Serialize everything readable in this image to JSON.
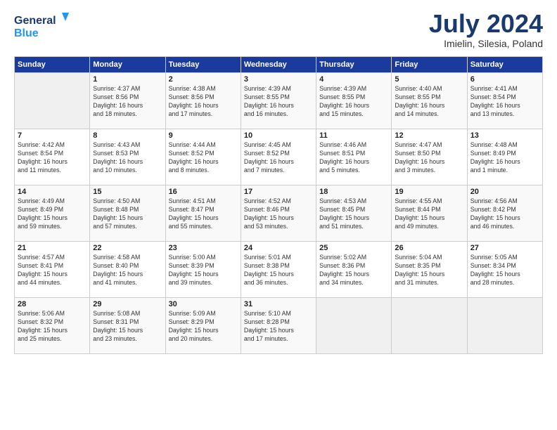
{
  "header": {
    "logo_line1": "General",
    "logo_line2": "Blue",
    "month": "July 2024",
    "location": "Imielin, Silesia, Poland"
  },
  "weekdays": [
    "Sunday",
    "Monday",
    "Tuesday",
    "Wednesday",
    "Thursday",
    "Friday",
    "Saturday"
  ],
  "weeks": [
    [
      {
        "day": "",
        "info": ""
      },
      {
        "day": "1",
        "info": "Sunrise: 4:37 AM\nSunset: 8:56 PM\nDaylight: 16 hours\nand 18 minutes."
      },
      {
        "day": "2",
        "info": "Sunrise: 4:38 AM\nSunset: 8:56 PM\nDaylight: 16 hours\nand 17 minutes."
      },
      {
        "day": "3",
        "info": "Sunrise: 4:39 AM\nSunset: 8:55 PM\nDaylight: 16 hours\nand 16 minutes."
      },
      {
        "day": "4",
        "info": "Sunrise: 4:39 AM\nSunset: 8:55 PM\nDaylight: 16 hours\nand 15 minutes."
      },
      {
        "day": "5",
        "info": "Sunrise: 4:40 AM\nSunset: 8:55 PM\nDaylight: 16 hours\nand 14 minutes."
      },
      {
        "day": "6",
        "info": "Sunrise: 4:41 AM\nSunset: 8:54 PM\nDaylight: 16 hours\nand 13 minutes."
      }
    ],
    [
      {
        "day": "7",
        "info": "Sunrise: 4:42 AM\nSunset: 8:54 PM\nDaylight: 16 hours\nand 11 minutes."
      },
      {
        "day": "8",
        "info": "Sunrise: 4:43 AM\nSunset: 8:53 PM\nDaylight: 16 hours\nand 10 minutes."
      },
      {
        "day": "9",
        "info": "Sunrise: 4:44 AM\nSunset: 8:52 PM\nDaylight: 16 hours\nand 8 minutes."
      },
      {
        "day": "10",
        "info": "Sunrise: 4:45 AM\nSunset: 8:52 PM\nDaylight: 16 hours\nand 7 minutes."
      },
      {
        "day": "11",
        "info": "Sunrise: 4:46 AM\nSunset: 8:51 PM\nDaylight: 16 hours\nand 5 minutes."
      },
      {
        "day": "12",
        "info": "Sunrise: 4:47 AM\nSunset: 8:50 PM\nDaylight: 16 hours\nand 3 minutes."
      },
      {
        "day": "13",
        "info": "Sunrise: 4:48 AM\nSunset: 8:49 PM\nDaylight: 16 hours\nand 1 minute."
      }
    ],
    [
      {
        "day": "14",
        "info": "Sunrise: 4:49 AM\nSunset: 8:49 PM\nDaylight: 15 hours\nand 59 minutes."
      },
      {
        "day": "15",
        "info": "Sunrise: 4:50 AM\nSunset: 8:48 PM\nDaylight: 15 hours\nand 57 minutes."
      },
      {
        "day": "16",
        "info": "Sunrise: 4:51 AM\nSunset: 8:47 PM\nDaylight: 15 hours\nand 55 minutes."
      },
      {
        "day": "17",
        "info": "Sunrise: 4:52 AM\nSunset: 8:46 PM\nDaylight: 15 hours\nand 53 minutes."
      },
      {
        "day": "18",
        "info": "Sunrise: 4:53 AM\nSunset: 8:45 PM\nDaylight: 15 hours\nand 51 minutes."
      },
      {
        "day": "19",
        "info": "Sunrise: 4:55 AM\nSunset: 8:44 PM\nDaylight: 15 hours\nand 49 minutes."
      },
      {
        "day": "20",
        "info": "Sunrise: 4:56 AM\nSunset: 8:42 PM\nDaylight: 15 hours\nand 46 minutes."
      }
    ],
    [
      {
        "day": "21",
        "info": "Sunrise: 4:57 AM\nSunset: 8:41 PM\nDaylight: 15 hours\nand 44 minutes."
      },
      {
        "day": "22",
        "info": "Sunrise: 4:58 AM\nSunset: 8:40 PM\nDaylight: 15 hours\nand 41 minutes."
      },
      {
        "day": "23",
        "info": "Sunrise: 5:00 AM\nSunset: 8:39 PM\nDaylight: 15 hours\nand 39 minutes."
      },
      {
        "day": "24",
        "info": "Sunrise: 5:01 AM\nSunset: 8:38 PM\nDaylight: 15 hours\nand 36 minutes."
      },
      {
        "day": "25",
        "info": "Sunrise: 5:02 AM\nSunset: 8:36 PM\nDaylight: 15 hours\nand 34 minutes."
      },
      {
        "day": "26",
        "info": "Sunrise: 5:04 AM\nSunset: 8:35 PM\nDaylight: 15 hours\nand 31 minutes."
      },
      {
        "day": "27",
        "info": "Sunrise: 5:05 AM\nSunset: 8:34 PM\nDaylight: 15 hours\nand 28 minutes."
      }
    ],
    [
      {
        "day": "28",
        "info": "Sunrise: 5:06 AM\nSunset: 8:32 PM\nDaylight: 15 hours\nand 25 minutes."
      },
      {
        "day": "29",
        "info": "Sunrise: 5:08 AM\nSunset: 8:31 PM\nDaylight: 15 hours\nand 23 minutes."
      },
      {
        "day": "30",
        "info": "Sunrise: 5:09 AM\nSunset: 8:29 PM\nDaylight: 15 hours\nand 20 minutes."
      },
      {
        "day": "31",
        "info": "Sunrise: 5:10 AM\nSunset: 8:28 PM\nDaylight: 15 hours\nand 17 minutes."
      },
      {
        "day": "",
        "info": ""
      },
      {
        "day": "",
        "info": ""
      },
      {
        "day": "",
        "info": ""
      }
    ]
  ]
}
